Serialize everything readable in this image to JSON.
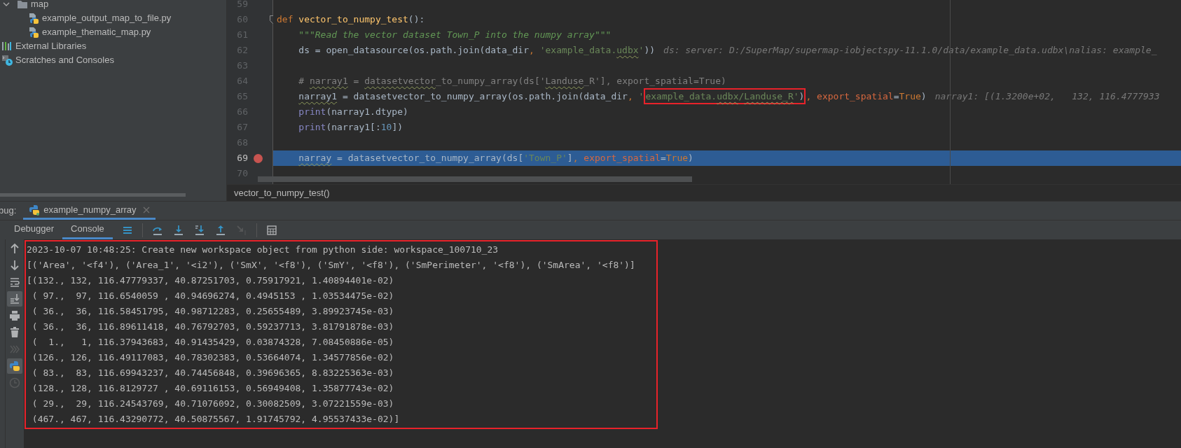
{
  "project_tree": [
    {
      "label": "map",
      "kind": "folder",
      "expanded": true,
      "children": [
        {
          "label": "example_output_map_to_file.py",
          "kind": "python-file"
        },
        {
          "label": "example_thematic_map.py",
          "kind": "python-file"
        }
      ]
    },
    {
      "label": "External Libraries",
      "kind": "libraries"
    },
    {
      "label": "Scratches and Consoles",
      "kind": "scratches"
    }
  ],
  "editor": {
    "lines": [
      {
        "number": "59",
        "breakpoint": false,
        "current": false,
        "fold": false
      },
      {
        "number": "60",
        "breakpoint": false,
        "current": false,
        "fold": true,
        "tokens": [
          {
            "kind": "keyword",
            "text": "def"
          },
          {
            "kind": "funcdef",
            "text": " vector_to_numpy_test"
          },
          {
            "kind": "plain",
            "text": "():"
          }
        ]
      },
      {
        "number": "61",
        "breakpoint": false,
        "current": false,
        "fold": false,
        "tokens": [
          {
            "kind": "docstring",
            "text": "    \"\"\"Read the vector dataset Town_P into the numpy array\"\"\""
          }
        ]
      },
      {
        "number": "62",
        "breakpoint": false,
        "current": false,
        "fold": false,
        "tokens": [
          {
            "kind": "plain",
            "text": "    ds = open_datasource(os.path.join(data_dir"
          },
          {
            "kind": "keyword",
            "text": ","
          },
          {
            "kind": "string",
            "text": " 'example_data."
          },
          {
            "kind": "string",
            "text": "udbx",
            "typo": true
          },
          {
            "kind": "string",
            "text": "'"
          },
          {
            "kind": "plain",
            "text": "))"
          },
          {
            "kind": "hint",
            "text": "ds: server: D:/SuperMap/supermap-iobjectspy-11.1.0/data/example_data.udbx\\nalias: example_"
          }
        ]
      },
      {
        "number": "63",
        "breakpoint": false,
        "current": false,
        "fold": false
      },
      {
        "number": "64",
        "breakpoint": false,
        "current": false,
        "fold": false,
        "tokens": [
          {
            "kind": "comment",
            "text": "    # "
          },
          {
            "kind": "comment",
            "text": "narray1",
            "typo": true
          },
          {
            "kind": "comment",
            "text": " = "
          },
          {
            "kind": "comment",
            "text": "datasetvector",
            "typo": true
          },
          {
            "kind": "comment",
            "text": "_to_numpy_array(ds['"
          },
          {
            "kind": "comment",
            "text": "Landuse",
            "typo": true
          },
          {
            "kind": "comment",
            "text": "_R'], export_spatial=True)"
          }
        ]
      },
      {
        "number": "65",
        "breakpoint": false,
        "current": false,
        "fold": false,
        "tokens": [
          {
            "kind": "plain",
            "text": "    narray1",
            "typo": true
          },
          {
            "kind": "plain",
            "text": " = datasetvector_to_numpy_array(os.path.join(data_dir"
          },
          {
            "kind": "keyword",
            "text": ","
          },
          {
            "kind": "string",
            "text": " '"
          },
          {
            "kind": "string",
            "text": "example_data.",
            "boxed": true
          },
          {
            "kind": "string",
            "text": "udbx",
            "typo": true,
            "boxed": true
          },
          {
            "kind": "string",
            "text": "/",
            "boxed": true
          },
          {
            "kind": "string",
            "text": "Landuse_R",
            "typo": true,
            "boxed": true
          },
          {
            "kind": "string",
            "text": "'",
            "boxed": true
          },
          {
            "kind": "plain",
            "text": ")",
            "boxed": true
          },
          {
            "kind": "keyword",
            "text": ","
          },
          {
            "kind": "param",
            "text": " export_spatial"
          },
          {
            "kind": "plain",
            "text": "="
          },
          {
            "kind": "keyword",
            "text": "True"
          },
          {
            "kind": "plain",
            "text": ")"
          },
          {
            "kind": "hint",
            "text": "narray1: [(1.3200e+02,   132, 116.4777933"
          }
        ]
      },
      {
        "number": "66",
        "breakpoint": false,
        "current": false,
        "fold": false,
        "tokens": [
          {
            "kind": "builtin",
            "text": "    print"
          },
          {
            "kind": "plain",
            "text": "(narray1.dtype)"
          }
        ]
      },
      {
        "number": "67",
        "breakpoint": false,
        "current": false,
        "fold": false,
        "tokens": [
          {
            "kind": "builtin",
            "text": "    print"
          },
          {
            "kind": "plain",
            "text": "(narray1[:"
          },
          {
            "kind": "number",
            "text": "10"
          },
          {
            "kind": "plain",
            "text": "])"
          }
        ]
      },
      {
        "number": "68",
        "breakpoint": false,
        "current": false,
        "fold": false
      },
      {
        "number": "69",
        "breakpoint": true,
        "current": true,
        "fold": false,
        "tokens": [
          {
            "kind": "plain",
            "text": "    narray",
            "typo": true
          },
          {
            "kind": "plain",
            "text": " = datasetvector_to_numpy_array(ds["
          },
          {
            "kind": "string",
            "text": "'Town_P'"
          },
          {
            "kind": "plain",
            "text": "]"
          },
          {
            "kind": "keyword",
            "text": ","
          },
          {
            "kind": "param",
            "text": " export_spatial"
          },
          {
            "kind": "plain",
            "text": "="
          },
          {
            "kind": "keyword",
            "text": "True"
          },
          {
            "kind": "plain",
            "text": ")"
          }
        ]
      },
      {
        "number": "70",
        "breakpoint": false,
        "current": false,
        "fold": false
      }
    ],
    "breadcrumb": "vector_to_numpy_test()"
  },
  "debug_panel": {
    "label": "bug:",
    "tabs": [
      {
        "title": "example_numpy_array",
        "selected": true
      }
    ],
    "subtabs": [
      {
        "label": "Debugger",
        "selected": false
      },
      {
        "label": "Console",
        "selected": true
      }
    ],
    "toolbar": [
      {
        "kind": "menu",
        "disabled": false
      },
      {
        "kind": "step-over",
        "disabled": false
      },
      {
        "kind": "step-into",
        "disabled": false
      },
      {
        "kind": "step-into-my",
        "disabled": false
      },
      {
        "kind": "step-out",
        "disabled": false
      },
      {
        "kind": "run-to-cursor",
        "disabled": true
      },
      {
        "kind": "evaluate",
        "disabled": false
      }
    ],
    "side_tools": [
      {
        "kind": "up",
        "selected": false,
        "disabled": false
      },
      {
        "kind": "down",
        "selected": false,
        "disabled": false
      },
      {
        "kind": "wrap",
        "selected": false,
        "disabled": false
      },
      {
        "kind": "scroll-end",
        "selected": true,
        "disabled": false
      },
      {
        "kind": "print",
        "selected": false,
        "disabled": false
      },
      {
        "kind": "trash",
        "selected": false,
        "disabled": false
      },
      {
        "kind": "more",
        "selected": false,
        "disabled": true
      },
      {
        "kind": "python",
        "selected": true,
        "disabled": false
      },
      {
        "kind": "history",
        "selected": false,
        "disabled": true
      }
    ]
  },
  "console": {
    "highlighted": true,
    "lines": [
      "2023-10-07 10:48:25: Create new workspace object from python side: workspace_100710_23",
      "[('Area', '<f4'), ('Area_1', '<i2'), ('SmX', '<f8'), ('SmY', '<f8'), ('SmPerimeter', '<f8'), ('SmArea', '<f8')]",
      "[(132., 132, 116.47779337, 40.87251703, 0.75917921, 1.40894401e-02)",
      " ( 97.,  97, 116.6540059 , 40.94696274, 0.4945153 , 1.03534475e-02)",
      " ( 36.,  36, 116.58451795, 40.98712283, 0.25655489, 3.89923745e-03)",
      " ( 36.,  36, 116.89611418, 40.76792703, 0.59237713, 3.81791878e-03)",
      " (  1.,   1, 116.37943683, 40.91435429, 0.03874328, 7.08450886e-05)",
      " (126., 126, 116.49117083, 40.78302383, 0.53664074, 1.34577856e-02)",
      " ( 83.,  83, 116.69943237, 40.74456848, 0.39696365, 8.83225363e-03)",
      " (128., 128, 116.8129727 , 40.69116153, 0.56949408, 1.35877743e-02)",
      " ( 29.,  29, 116.24543769, 40.71076092, 0.30082509, 3.07221559e-03)",
      " (467., 467, 116.43290772, 40.50875567, 1.91745792, 4.95537433e-02)]"
    ]
  }
}
